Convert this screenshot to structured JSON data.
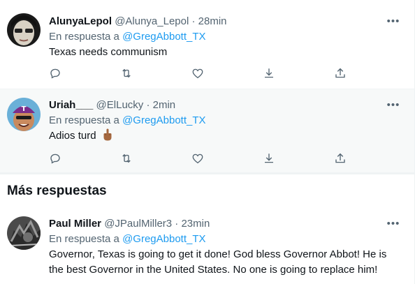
{
  "tweets": [
    {
      "name": "AlunyaLepol",
      "handle": "@Alunya_Lepol",
      "sep": "·",
      "time": "28min",
      "reply_prefix": "En respuesta a ",
      "reply_mention": "@GregAbbott_TX",
      "text": "Texas needs communism",
      "more": "•••"
    },
    {
      "name": "Uriah___",
      "handle": "@ElLucky",
      "sep": "·",
      "time": "2min",
      "reply_prefix": "En respuesta a ",
      "reply_mention": "@GregAbbott_TX",
      "text": "Adios turd",
      "more": "•••"
    }
  ],
  "section": {
    "title": "Más respuestas"
  },
  "more_replies": [
    {
      "name": "Paul Miller",
      "handle": "@JPaulMiller3",
      "sep": "·",
      "time": "23min",
      "reply_prefix": "En respuesta a ",
      "reply_mention": "@GregAbbott_TX",
      "text": "Governor, Texas is going to get it done!  God bless Governor Abbot!  He is the best Governor in the United States.  No one is going to replace him!",
      "more": "•••"
    }
  ],
  "colors": {
    "accent": "#1d9bf0",
    "secondary": "#536471",
    "text": "#0f1419",
    "highlight_bg": "#f7f9f9"
  },
  "icons": [
    "reply-icon",
    "retweet-icon",
    "like-icon",
    "share-icon",
    "upload-icon",
    "more-icon",
    "middle-finger-emoji"
  ]
}
